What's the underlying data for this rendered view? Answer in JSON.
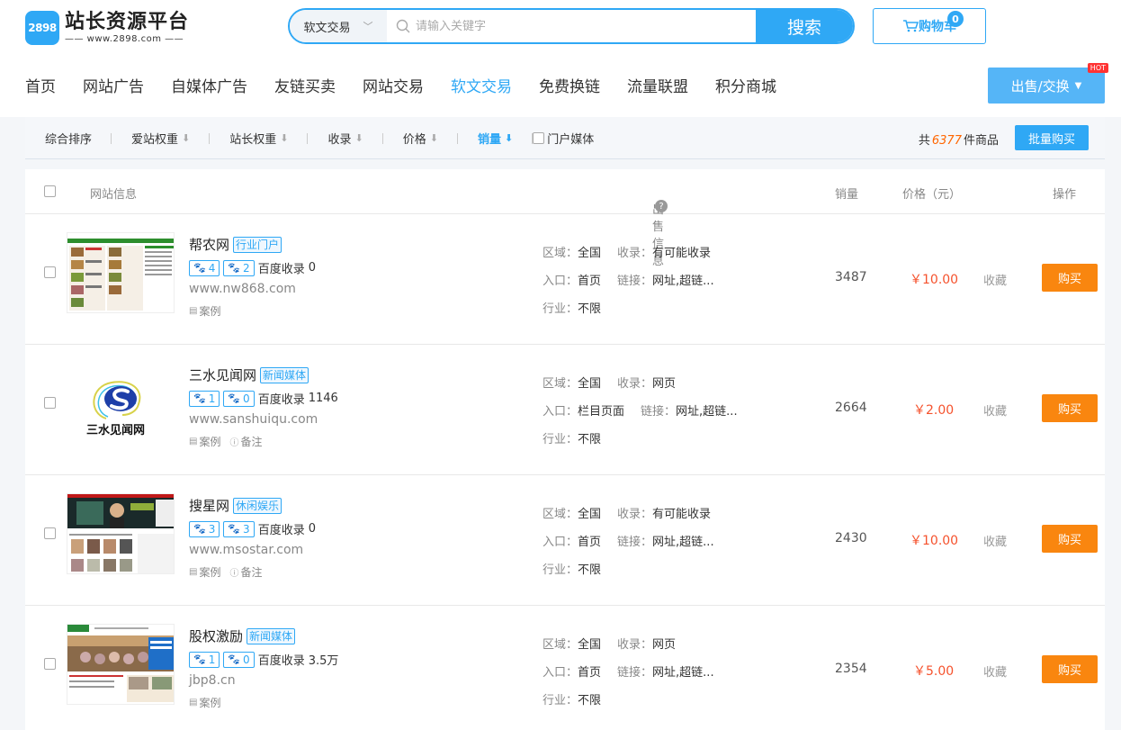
{
  "header": {
    "logo_badge": "2898",
    "logo_title": "站长资源平台",
    "logo_sub": "—— www.2898.com ——",
    "search_category": "软文交易",
    "search_placeholder": "请输入关键字",
    "search_button": "搜索",
    "cart_label": "购物车",
    "cart_count": "0",
    "sell_label": "出售/交换",
    "hot_label": "HOT"
  },
  "nav": [
    "首页",
    "网站广告",
    "自媒体广告",
    "友链买卖",
    "网站交易",
    "软文交易",
    "免费换链",
    "流量联盟",
    "积分商城"
  ],
  "nav_active": "软文交易",
  "sortbar": {
    "items": [
      "综合排序",
      "爱站权重",
      "站长权重",
      "收录",
      "价格",
      "销量"
    ],
    "portal_label": "门户媒体",
    "total_prefix": "共",
    "total_count": "6377",
    "total_suffix": "件商品",
    "bulk_button": "批量购买"
  },
  "table_header": {
    "site_info": "网站信息",
    "sale_info": "出售信息",
    "sales": "销量",
    "price": "价格（元）",
    "action": "操作"
  },
  "labels": {
    "region": "区域：",
    "index": "收录：",
    "entry": "入口：",
    "link": "链接：",
    "industry": "行业：",
    "baidu_index": "百度收录",
    "case": "案例",
    "filing": "备注",
    "fav": "收藏",
    "buy": "购买"
  },
  "rows": [
    {
      "name": "帮农网",
      "tag": "行业门户",
      "aizhan": "4",
      "zhanzhang": "2",
      "baidu": "0",
      "url": "www.nw868.com",
      "has_filing": false,
      "region": "全国",
      "index": "有可能收录",
      "entry": "首页",
      "link": "网址,超链...",
      "industry": "不限",
      "sales": "3487",
      "price": "￥10.00"
    },
    {
      "name": "三水见闻网",
      "tag": "新闻媒体",
      "aizhan": "1",
      "zhanzhang": "0",
      "baidu": "1146",
      "url": "www.sanshuiqu.com",
      "has_filing": true,
      "region": "全国",
      "index": "网页",
      "entry": "栏目页面",
      "link": "网址,超链...",
      "industry": "不限",
      "sales": "2664",
      "price": "￥2.00"
    },
    {
      "name": "搜星网",
      "tag": "休闲娱乐",
      "aizhan": "3",
      "zhanzhang": "3",
      "baidu": "0",
      "url": "www.msostar.com",
      "has_filing": true,
      "region": "全国",
      "index": "有可能收录",
      "entry": "首页",
      "link": "网址,超链...",
      "industry": "不限",
      "sales": "2430",
      "price": "￥10.00"
    },
    {
      "name": "股权激励",
      "tag": "新闻媒体",
      "aizhan": "1",
      "zhanzhang": "0",
      "baidu": "3.5万",
      "url": "jbp8.cn",
      "has_filing": false,
      "region": "全国",
      "index": "网页",
      "entry": "首页",
      "link": "网址,超链...",
      "industry": "不限",
      "sales": "2354",
      "price": "￥5.00"
    }
  ],
  "logo_text_row2": "三水见闻网",
  "colors": {
    "accent": "#2fa8f5",
    "buy": "#f9860f",
    "price": "#f5522d"
  }
}
